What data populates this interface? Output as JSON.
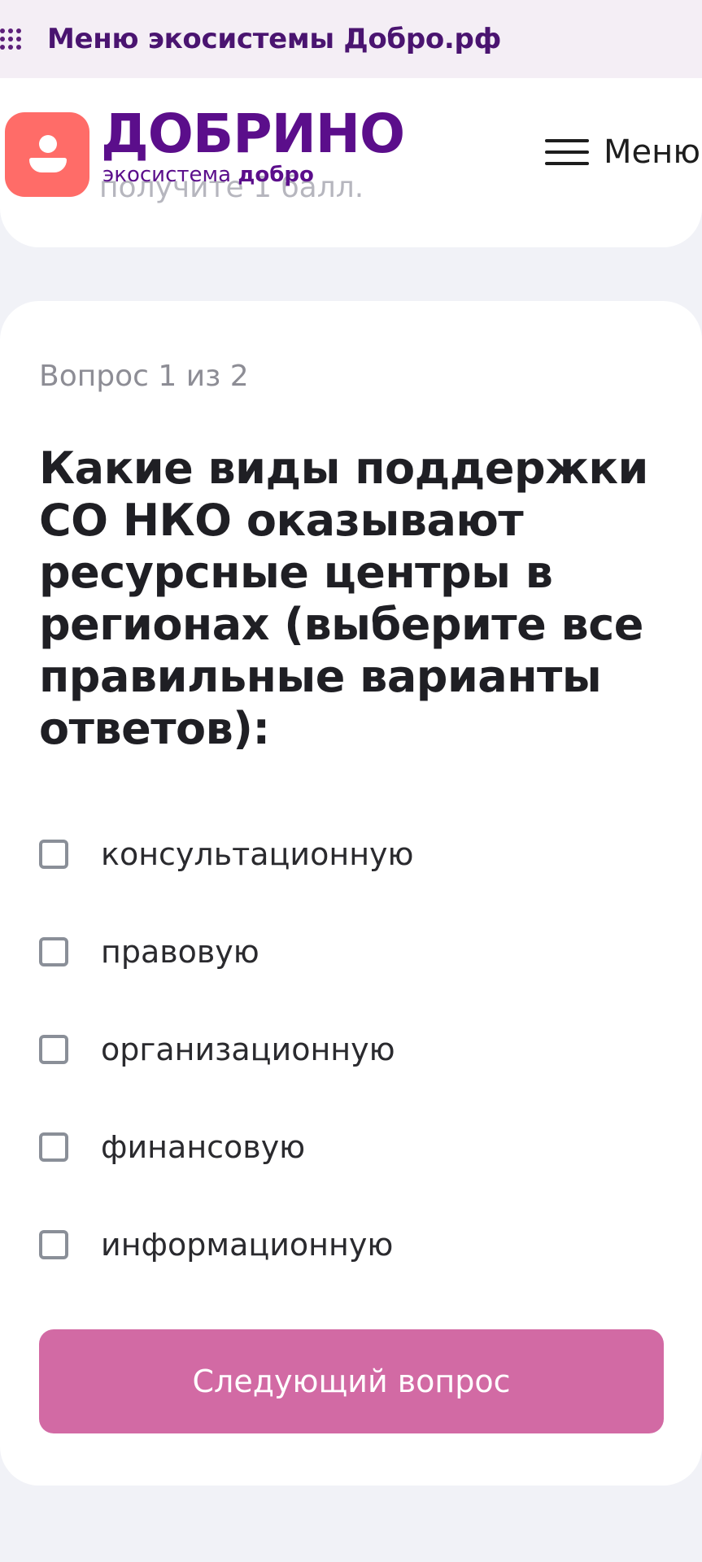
{
  "eco_bar": {
    "icon": "grid-dots-icon",
    "label": "Меню экосистемы Добро.рф"
  },
  "header": {
    "logo_title": "ДОБРИНО",
    "logo_sub_prefix": "экосистема",
    "logo_sub_brand": "добро",
    "menu_label": "Меню",
    "menu_icon": "hamburger-icon",
    "ghost_text": "получите 1 балл."
  },
  "quiz": {
    "counter": "Вопрос 1 из 2",
    "question": "Какие виды поддержки СО НКО оказывают ресурсные центры в регионах (выберите все правильные варианты ответов):",
    "options": [
      {
        "label": "консультационную",
        "checked": false
      },
      {
        "label": "правовую",
        "checked": false
      },
      {
        "label": "организационную",
        "checked": false
      },
      {
        "label": "финансовую",
        "checked": false
      },
      {
        "label": "информационную",
        "checked": false
      }
    ],
    "next_button": "Следующий вопрос"
  },
  "colors": {
    "brand_purple": "#5b0e8b",
    "logo_coral": "#ff6c68",
    "button_pink": "#d26aa4"
  }
}
